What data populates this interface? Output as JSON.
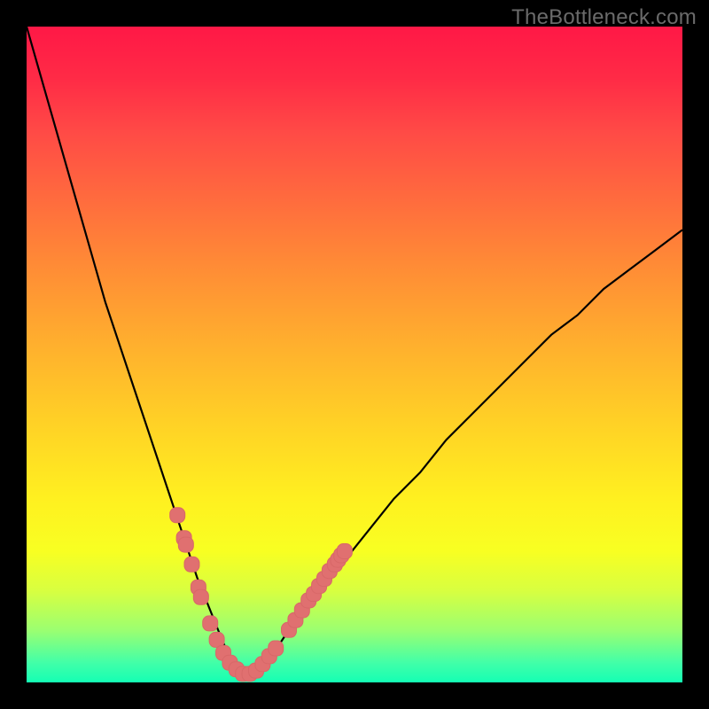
{
  "watermark": "TheBottleneck.com",
  "colors": {
    "frame": "#000000",
    "curve": "#000000",
    "marker_fill": "#e07070",
    "marker_stroke": "#d86868"
  },
  "chart_data": {
    "type": "line",
    "title": "",
    "xlabel": "",
    "ylabel": "",
    "xlim": [
      0,
      100
    ],
    "ylim": [
      0,
      100
    ],
    "grid": false,
    "legend": false,
    "note": "Bottleneck-style V curve; y=0 (bottom) is optimal, higher y = worse. Minimum near x≈33.",
    "series": [
      {
        "name": "bottleneck-curve",
        "x": [
          0,
          2,
          4,
          6,
          8,
          10,
          12,
          14,
          16,
          18,
          20,
          22,
          24,
          26,
          28,
          30,
          31,
          32,
          33,
          34,
          35,
          36,
          38,
          40,
          44,
          48,
          52,
          56,
          60,
          64,
          68,
          72,
          76,
          80,
          84,
          88,
          92,
          96,
          100
        ],
        "y": [
          100,
          93,
          86,
          79,
          72,
          65,
          58,
          52,
          46,
          40,
          34,
          28,
          22,
          16,
          11,
          6,
          4,
          2,
          1,
          1,
          2,
          3,
          5,
          8,
          13,
          18,
          23,
          28,
          32,
          37,
          41,
          45,
          49,
          53,
          56,
          60,
          63,
          66,
          69
        ]
      }
    ],
    "markers": {
      "name": "highlighted-points",
      "note": "pink rounded markers along lower part of curve",
      "points": [
        {
          "x": 23.0,
          "y": 25.5
        },
        {
          "x": 24.0,
          "y": 22.0
        },
        {
          "x": 24.3,
          "y": 21.0
        },
        {
          "x": 25.2,
          "y": 18.0
        },
        {
          "x": 26.2,
          "y": 14.5
        },
        {
          "x": 26.6,
          "y": 13.0
        },
        {
          "x": 28.0,
          "y": 9.0
        },
        {
          "x": 29.0,
          "y": 6.5
        },
        {
          "x": 30.0,
          "y": 4.5
        },
        {
          "x": 31.0,
          "y": 3.0
        },
        {
          "x": 32.0,
          "y": 2.0
        },
        {
          "x": 33.0,
          "y": 1.3
        },
        {
          "x": 34.0,
          "y": 1.3
        },
        {
          "x": 35.0,
          "y": 1.8
        },
        {
          "x": 36.0,
          "y": 2.8
        },
        {
          "x": 37.0,
          "y": 4.0
        },
        {
          "x": 38.0,
          "y": 5.2
        },
        {
          "x": 40.0,
          "y": 8.0
        },
        {
          "x": 41.0,
          "y": 9.5
        },
        {
          "x": 42.0,
          "y": 11.0
        },
        {
          "x": 43.0,
          "y": 12.5
        },
        {
          "x": 43.8,
          "y": 13.5
        },
        {
          "x": 44.6,
          "y": 14.7
        },
        {
          "x": 45.4,
          "y": 15.8
        },
        {
          "x": 46.2,
          "y": 17.0
        },
        {
          "x": 47.0,
          "y": 18.0
        },
        {
          "x": 47.5,
          "y": 18.7
        },
        {
          "x": 48.0,
          "y": 19.4
        },
        {
          "x": 48.5,
          "y": 20.0
        }
      ]
    }
  }
}
